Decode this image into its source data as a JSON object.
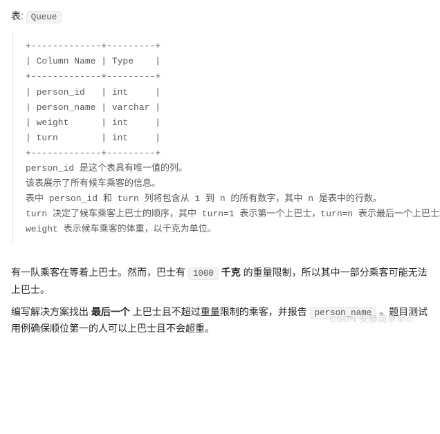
{
  "intro": {
    "prefix": "表: ",
    "table_code": "Queue"
  },
  "schema_block": "+-------------+---------+\n| Column Name | Type    |\n+-------------+---------+\n| person_id   | int     |\n| person_name | varchar |\n| weight      | int     |\n| turn        | int     |\n+-------------+---------+\nperson_id 是这个表具有唯一值的列。\n该表展示了所有候车乘客的信息。\n表中 person_id 和 turn 列将包含从 1 到 n 的所有数字，其中 n 是表中的行数。\nturn 决定了候车乘客上巴士的顺序，其中 turn=1 表示第一个上巴士，turn=n 表示最后一个上巴士。\nweight 表示候车乘客的体重，以千克为单位。",
  "para1": {
    "p1": "有一队乘客在等着上巴士。然而，巴士有 ",
    "code": "1000",
    "p2": " ",
    "bold": "千克",
    "p3": " 的重量限制，所以其中一部分乘客可能无法上巴士。"
  },
  "para2": {
    "p1": "编写解决方案找出 ",
    "bold": "最后一个",
    "p2": " 上巴士且不超过重量限制的乘客，并报告 ",
    "code": "person_name",
    "p3": " 。题目测试用例确保顺位第一的人可以上巴士且不会超重。"
  },
  "watermark": "CSDN 安静简单单di"
}
